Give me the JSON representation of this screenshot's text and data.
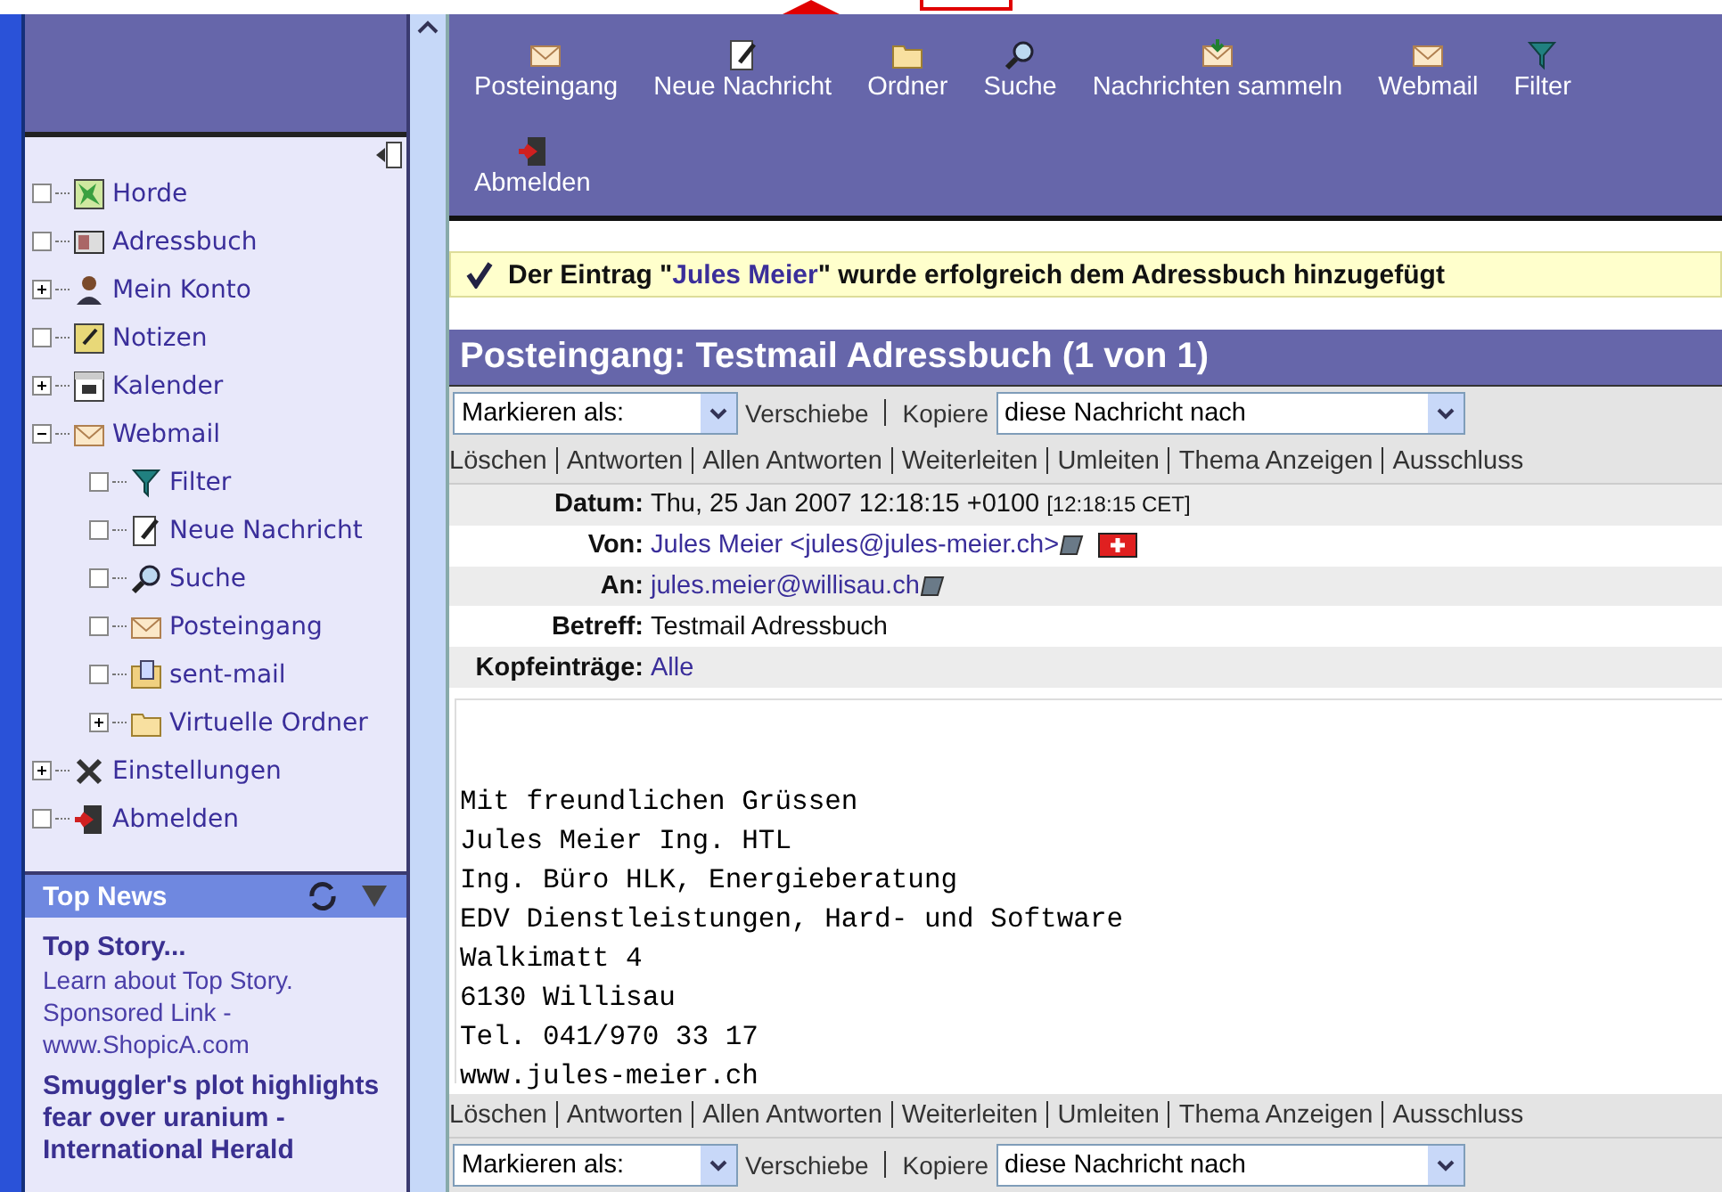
{
  "sidebar": {
    "tree": [
      {
        "label": "Horde",
        "kind": "leaf"
      },
      {
        "label": "Adressbuch",
        "kind": "leaf"
      },
      {
        "label": "Mein Konto",
        "kind": "folder",
        "expanded": false
      },
      {
        "label": "Notizen",
        "kind": "leaf"
      },
      {
        "label": "Kalender",
        "kind": "folder",
        "expanded": false
      },
      {
        "label": "Webmail",
        "kind": "folder",
        "expanded": true,
        "children": [
          {
            "label": "Filter",
            "kind": "leaf"
          },
          {
            "label": "Neue Nachricht",
            "kind": "leaf"
          },
          {
            "label": "Suche",
            "kind": "leaf"
          },
          {
            "label": "Posteingang",
            "kind": "leaf"
          },
          {
            "label": "sent-mail",
            "kind": "leaf"
          },
          {
            "label": "Virtuelle Ordner",
            "kind": "folder",
            "expanded": false
          }
        ]
      },
      {
        "label": "Einstellungen",
        "kind": "folder",
        "expanded": false
      },
      {
        "label": "Abmelden",
        "kind": "leaf"
      }
    ],
    "news": {
      "title": "Top News",
      "items": [
        {
          "headline": "Top Story...",
          "text": "Learn about Top Story. Sponsored Link - www.ShopicA.com"
        },
        {
          "headline": "Smuggler's plot highlights fear over uranium - International Herald"
        }
      ]
    }
  },
  "toolbar": [
    "Posteingang",
    "Neue Nachricht",
    "Ordner",
    "Suche",
    "Nachrichten sammeln",
    "Webmail",
    "Filter",
    "Abmelden"
  ],
  "notification": {
    "before": "Der Eintrag \"",
    "name": "Jules Meier",
    "after": "\" wurde erfolgreich dem Adressbuch hinzugefügt"
  },
  "message": {
    "title": "Posteingang: Testmail Adressbuch (1 von 1)",
    "top_controls": {
      "mark_select": "Markieren als:",
      "move": "Verschiebe",
      "copy": "Kopiere",
      "target_select": "diese Nachricht nach"
    },
    "top_actions": [
      "Löschen",
      "Antworten",
      "Allen Antworten",
      "Weiterleiten",
      "Umleiten",
      "Thema Anzeigen",
      "Ausschluss"
    ],
    "headers": [
      {
        "label": "Datum:",
        "value": "Thu, 25 Jan 2007 12:18:15 +0100",
        "note": "[12:18:15 CET]"
      },
      {
        "label": "Von:",
        "value": "Jules Meier <jules@jules-meier.ch>",
        "link": true,
        "book": true,
        "flag": true
      },
      {
        "label": "An:",
        "value": "jules.meier@willisau.ch",
        "link": true,
        "book": true
      },
      {
        "label": "Betreff:",
        "value": "Testmail Adressbuch"
      },
      {
        "label": "Kopfeinträge:",
        "value": "Alle",
        "link": true
      }
    ],
    "body": [
      "Mit freundlichen Grüssen",
      "Jules Meier Ing. HTL",
      "Ing. Büro HLK, Energieberatung",
      "EDV Dienstleistungen, Hard- und Software",
      "Walkimatt 4",
      "6130 Willisau",
      "Tel. 041/970 33 17",
      "www.jules-meier.ch"
    ],
    "bottom_actions": [
      "Löschen",
      "Antworten",
      "Allen Antworten",
      "Weiterleiten",
      "Umleiten",
      "Thema Anzeigen",
      "Ausschluss"
    ],
    "bottom_controls": {
      "mark_select": "Markieren als:",
      "move": "Verschiebe",
      "copy": "Kopiere",
      "target_select": "diese Nachricht nach"
    }
  }
}
